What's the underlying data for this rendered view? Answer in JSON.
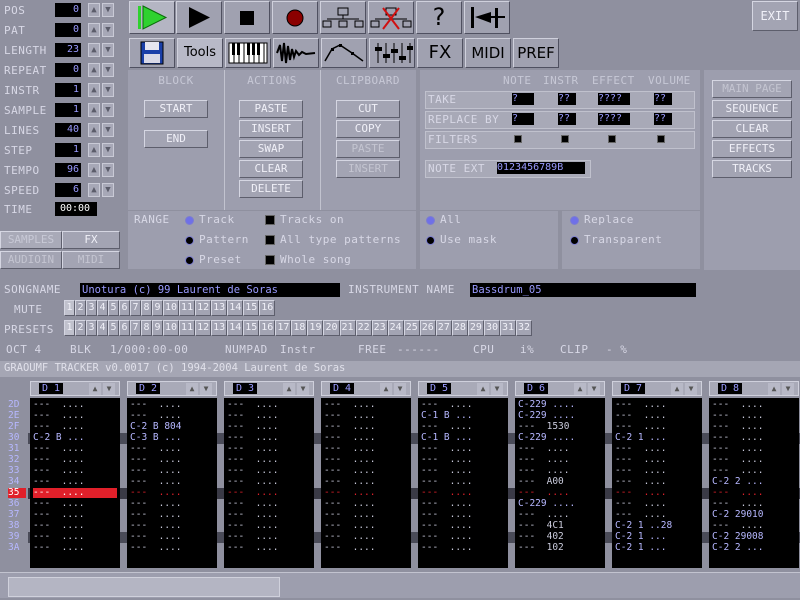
{
  "left_params": [
    {
      "label": "POS",
      "value": "0"
    },
    {
      "label": "PAT",
      "value": "0"
    },
    {
      "label": "LENGTH",
      "value": "23"
    },
    {
      "label": "REPEAT",
      "value": "0"
    },
    {
      "label": "INSTR",
      "value": "1"
    },
    {
      "label": "SAMPLE",
      "value": "1"
    },
    {
      "label": "LINES",
      "value": "40"
    },
    {
      "label": "STEP",
      "value": "1"
    },
    {
      "label": "TEMPO",
      "value": "96"
    },
    {
      "label": "SPEED",
      "value": "6"
    }
  ],
  "time": {
    "label": "TIME",
    "value": "00:00"
  },
  "left_tabs": {
    "samples": "SAMPLES",
    "fx": "FX",
    "audioin": "AUDIOIN",
    "midi": "MIDI"
  },
  "toolbar": {
    "exit": "EXIT",
    "help": "?",
    "tools": "Tools",
    "fx": "FX",
    "midi": "MIDI",
    "pref": "PREF"
  },
  "block": {
    "title": "BLOCK",
    "start": "START",
    "end": "END"
  },
  "actions": {
    "title": "ACTIONS",
    "paste": "PASTE",
    "insert": "INSERT",
    "swap": "SWAP",
    "clear": "CLEAR",
    "delete": "DELETE"
  },
  "clipboard": {
    "title": "CLIPBOARD",
    "cut": "CUT",
    "copy": "COPY",
    "paste": "PASTE",
    "insert": "INSERT"
  },
  "replace_header": {
    "note": "NOTE",
    "instr": "INSTR",
    "effect": "EFFECT",
    "volume": "VOLUME"
  },
  "take": {
    "label": "TAKE",
    "note": "?",
    "instr": "??",
    "effect": "????",
    "volume": "??"
  },
  "replace_by": {
    "label": "REPLACE BY",
    "note": "?",
    "instr": "??",
    "effect": "????",
    "volume": "??"
  },
  "filters": {
    "label": "FILTERS"
  },
  "note_ext": {
    "label": "NOTE EXT",
    "value": "0123456789B"
  },
  "page_nav": {
    "main_page": "MAIN PAGE",
    "sequence": "SEQUENCE",
    "clear": "CLEAR",
    "effects": "EFFECTS",
    "tracks": "TRACKS"
  },
  "range": {
    "label": "RANGE",
    "track": "Track",
    "pattern": "Pattern",
    "preset": "Preset",
    "tracks_on": "Tracks on",
    "all_type_patterns": "All type patterns",
    "whole_song": "Whole song",
    "all": "All",
    "use_mask": "Use mask",
    "replace": "Replace",
    "transparent": "Transparent"
  },
  "songname": {
    "label": "SONGNAME",
    "value": "Unotura (c) 99 Laurent de Soras"
  },
  "instrument_name": {
    "label": "INSTRUMENT NAME",
    "value": "Bassdrum_05"
  },
  "mute": {
    "label": "MUTE",
    "items": [
      "1",
      "2",
      "3",
      "4",
      "5",
      "6",
      "7",
      "8",
      "9",
      "10",
      "11",
      "12",
      "13",
      "14",
      "15",
      "16"
    ]
  },
  "presets": {
    "label": "PRESETS",
    "items": [
      "1",
      "2",
      "3",
      "4",
      "5",
      "6",
      "7",
      "8",
      "9",
      "10",
      "11",
      "12",
      "13",
      "14",
      "15",
      "16",
      "17",
      "18",
      "19",
      "20",
      "21",
      "22",
      "23",
      "24",
      "25",
      "26",
      "27",
      "28",
      "29",
      "30",
      "31",
      "32"
    ]
  },
  "status": {
    "oct": "OCT 4",
    "blk": "BLK",
    "blk_val": "1/000:00-00",
    "numpad": "NUMPAD",
    "numpad_val": "Instr",
    "free": "FREE",
    "free_val": "------",
    "cpu": "CPU",
    "cpu_val": "i%",
    "clip": "CLIP",
    "clip_val": "- %"
  },
  "title_bar": "GRAOUMF TRACKER v0.0017 (c) 1994-2004 Laurent de Soras",
  "track_headers": [
    "D 1",
    "D 2",
    "D 3",
    "D 4",
    "D 5",
    "D 6",
    "D 7",
    "D 8"
  ],
  "row_numbers": [
    "2D",
    "2E",
    "2F",
    "30",
    "31",
    "32",
    "33",
    "34",
    "35",
    "36",
    "37",
    "38",
    "39",
    "3A"
  ],
  "tracks": [
    [
      "---  ....",
      "---  ....",
      "---  ....",
      "C-2 B ...",
      "---  ....",
      "---  ....",
      "---  ....",
      "---  ....",
      "---  ....",
      "---  ....",
      "---  ....",
      "---  ....",
      "---  ....",
      "---  ...."
    ],
    [
      "---  ....",
      "---  ....",
      "C-2 B 804",
      "C-3 B ...",
      "---  ....",
      "---  ....",
      "---  ....",
      "---  ....",
      "---  ....",
      "---  ....",
      "---  ....",
      "---  ....",
      "---  ....",
      "---  ...."
    ],
    [
      "---  ....",
      "---  ....",
      "---  ....",
      "---  ....",
      "---  ....",
      "---  ....",
      "---  ....",
      "---  ....",
      "---  ....",
      "---  ....",
      "---  ....",
      "---  ....",
      "---  ....",
      "---  ...."
    ],
    [
      "---  ....",
      "---  ....",
      "---  ....",
      "---  ....",
      "---  ....",
      "---  ....",
      "---  ....",
      "---  ....",
      "---  ....",
      "---  ....",
      "---  ....",
      "---  ....",
      "---  ....",
      "---  ...."
    ],
    [
      "---  ....",
      "C-1 B ...",
      "---  ....",
      "C-1 B ...",
      "---  ....",
      "---  ....",
      "---  ....",
      "---  ....",
      "---  ....",
      "---  ....",
      "---  ....",
      "---  ....",
      "---  ....",
      "---  ...."
    ],
    [
      "C-229 ....",
      "C-229 ....",
      "---  1530",
      "C-229 ....",
      "---  ....",
      "---  ....",
      "---  ....",
      "---  A00",
      "---  ....",
      "C-229 ....",
      "---  ....",
      "---  4C1",
      "---  402",
      "---  102"
    ],
    [
      "---  ....",
      "---  ....",
      "---  ....",
      "C-2 1 ...",
      "---  ....",
      "---  ....",
      "---  ....",
      "---  ....",
      "---  ....",
      "---  ....",
      "---  ....",
      "C-2 1 ..28",
      "C-2 1 ...",
      "C-2 1 ..."
    ],
    [
      "---  ....",
      "---  ....",
      "---  ....",
      "---  ....",
      "---  ....",
      "---  ....",
      "---  ....",
      "C-2 2 ...",
      "---  ....",
      "---  ....",
      "C-2 29010",
      "---  ....",
      "C-2 29008",
      "C-2 2 ..."
    ]
  ],
  "colors": {
    "background": "#8f909f",
    "highlight_row": "#e0202a",
    "field_text": "#9a9bff",
    "play_green": "#2fd12f"
  }
}
